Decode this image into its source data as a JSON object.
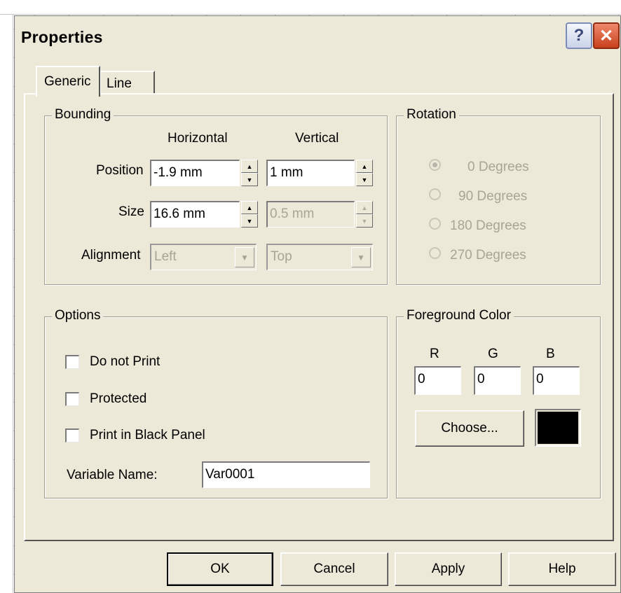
{
  "dialog": {
    "title": "Properties"
  },
  "tabs": [
    {
      "label": "Generic"
    },
    {
      "label": "Line"
    }
  ],
  "bounding": {
    "label": "Bounding",
    "col_horizontal": "Horizontal",
    "col_vertical": "Vertical",
    "position_label": "Position",
    "position_h": "-1.9 mm",
    "position_v": "1 mm",
    "size_label": "Size",
    "size_h": "16.6 mm",
    "size_v": "0.5 mm",
    "alignment_label": "Alignment",
    "alignment_h": "Left",
    "alignment_v": "Top"
  },
  "rotation": {
    "label": "Rotation",
    "options": [
      "0 Degrees",
      "90 Degrees",
      "180 Degrees",
      "270 Degrees"
    ],
    "selected": "0 Degrees"
  },
  "options": {
    "label": "Options",
    "do_not_print": "Do not Print",
    "protected": "Protected",
    "print_black_panel": "Print in Black Panel",
    "variable_name_label": "Variable Name:",
    "variable_name": "Var0001"
  },
  "foreground": {
    "label": "Foreground Color",
    "r_label": "R",
    "g_label": "G",
    "b_label": "B",
    "r": "0",
    "g": "0",
    "b": "0",
    "choose": "Choose...",
    "color": "#000000"
  },
  "buttons": {
    "ok": "OK",
    "cancel": "Cancel",
    "apply": "Apply",
    "help": "Help"
  },
  "titlebar": {
    "help_glyph": "?",
    "close_glyph": "✕"
  }
}
